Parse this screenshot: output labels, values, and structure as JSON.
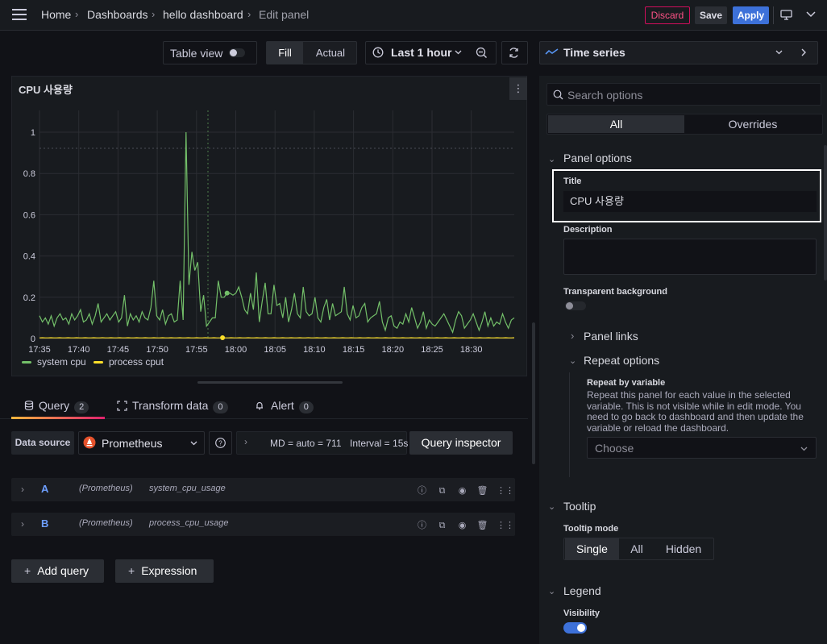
{
  "nav": {
    "breadcrumbs": [
      "Home",
      "Dashboards",
      "hello dashboard",
      "Edit panel"
    ],
    "discard": "Discard",
    "save": "Save",
    "apply": "Apply"
  },
  "toolbar": {
    "table_view": "Table view",
    "fill": "Fill",
    "actual": "Actual",
    "time_range": "Last 1 hour",
    "visualization": "Time series"
  },
  "panel": {
    "title": "CPU 사용량"
  },
  "chart_data": {
    "type": "line",
    "x_ticks": [
      "17:35",
      "17:40",
      "17:45",
      "17:50",
      "17:55",
      "18:00",
      "18:05",
      "18:10",
      "18:15",
      "18:20",
      "18:25",
      "18:30"
    ],
    "y_ticks": [
      "0",
      "0.2",
      "0.4",
      "0.6",
      "0.8",
      "1"
    ],
    "ylim": [
      0,
      1
    ],
    "series": [
      {
        "name": "system cpu",
        "color": "#73bf69",
        "values": [
          0.11,
          0.08,
          0.1,
          0.07,
          0.11,
          0.06,
          0.1,
          0.12,
          0.09,
          0.1,
          0.07,
          0.12,
          0.09,
          0.11,
          0.14,
          0.08,
          0.09,
          0.12,
          0.07,
          0.11,
          0.17,
          0.08,
          0.1,
          0.12,
          0.09,
          0.11,
          0.13,
          0.08,
          0.1,
          0.21,
          0.06,
          0.12,
          0.09,
          0.11,
          0.08,
          0.13,
          0.1,
          0.09,
          0.15,
          0.28,
          0.11,
          0.09,
          0.14,
          0.07,
          0.11,
          0.12,
          0.08,
          0.09,
          0.28,
          0.09,
          1.0,
          0.26,
          0.42,
          0.33,
          0.37,
          0.13,
          0.21,
          0.06,
          0.08,
          0.1,
          0.1,
          0.28,
          0.2,
          0.2,
          0.22,
          0.22,
          0.21,
          0.22,
          0.25,
          0.2,
          0.14,
          0.12,
          0.22,
          0.14,
          0.32,
          0.08,
          0.18,
          0.27,
          0.12,
          0.12,
          0.26,
          0.16,
          0.17,
          0.1,
          0.2,
          0.08,
          0.14,
          0.22,
          0.12,
          0.1,
          0.25,
          0.13,
          0.11,
          0.12,
          0.2,
          0.1,
          0.08,
          0.15,
          0.19,
          0.09,
          0.17,
          0.11,
          0.12,
          0.13,
          0.25,
          0.12,
          0.09,
          0.16,
          0.1,
          0.11,
          0.15,
          0.17,
          0.08,
          0.1,
          0.11,
          0.12,
          0.18,
          0.08,
          0.04,
          0.1,
          0.11,
          0.06,
          0.05,
          0.08,
          0.07,
          0.12,
          0.08,
          0.15,
          0.1,
          0.05,
          0.08,
          0.13,
          0.05,
          0.09,
          0.07,
          0.06,
          0.08,
          0.1,
          0.12,
          0.09,
          0.06,
          0.03,
          0.09,
          0.13,
          0.11,
          0.05,
          0.07,
          0.09,
          0.12,
          0.08,
          0.04,
          0.08,
          0.13,
          0.06,
          0.1,
          0.06,
          0.08,
          0.07,
          0.12,
          0.08,
          0.05,
          0.09,
          0.1
        ]
      },
      {
        "name": "process cput",
        "color": "#fade2a",
        "values": [
          0.003,
          0.004,
          0.003,
          0.003,
          0.004,
          0.003,
          0.003,
          0.004,
          0.003,
          0.003,
          0.004,
          0.003,
          0.003,
          0.004,
          0.003,
          0.003,
          0.004,
          0.003,
          0.003,
          0.004,
          0.003,
          0.003,
          0.004,
          0.003,
          0.003,
          0.004,
          0.003,
          0.003,
          0.004,
          0.003,
          0.003,
          0.004,
          0.003,
          0.003,
          0.004,
          0.003,
          0.003,
          0.004,
          0.003,
          0.003,
          0.004,
          0.003,
          0.003,
          0.004,
          0.003,
          0.003,
          0.004,
          0.003,
          0.003,
          0.004,
          0.003,
          0.003,
          0.004,
          0.003,
          0.003,
          0.004,
          0.003,
          0.003,
          0.004,
          0.003,
          0.003,
          0.004,
          0.003,
          0.003,
          0.004,
          0.003,
          0.003,
          0.004,
          0.003,
          0.003,
          0.004,
          0.003,
          0.003,
          0.004,
          0.003,
          0.003,
          0.004,
          0.003,
          0.003,
          0.004,
          0.003,
          0.003,
          0.004,
          0.003,
          0.003,
          0.004,
          0.003,
          0.003,
          0.004,
          0.003,
          0.003,
          0.004,
          0.003,
          0.003,
          0.004,
          0.003,
          0.003,
          0.004,
          0.003,
          0.003,
          0.004,
          0.003,
          0.003,
          0.004,
          0.003,
          0.003,
          0.004,
          0.003,
          0.003,
          0.004,
          0.003,
          0.003,
          0.004,
          0.003,
          0.003,
          0.004,
          0.003,
          0.003,
          0.004,
          0.003,
          0.003,
          0.004,
          0.003,
          0.003,
          0.004,
          0.003,
          0.003,
          0.004,
          0.003,
          0.003,
          0.004,
          0.003,
          0.003,
          0.004,
          0.003,
          0.003,
          0.004,
          0.003,
          0.003,
          0.004,
          0.003,
          0.003,
          0.004,
          0.003,
          0.003,
          0.004,
          0.003,
          0.003,
          0.004,
          0.003,
          0.003,
          0.004,
          0.003,
          0.003,
          0.004,
          0.003,
          0.003,
          0.004,
          0.003,
          0.003,
          0.004,
          0.003,
          0.003,
          0.004,
          0.003,
          0.003,
          0.004
        ]
      }
    ]
  },
  "query_tabs": [
    {
      "label": "Query",
      "count": "2"
    },
    {
      "label": "Transform data",
      "count": "0"
    },
    {
      "label": "Alert",
      "count": "0"
    }
  ],
  "datasource": {
    "label": "Data source",
    "name": "Prometheus",
    "options": "MD = auto = 711",
    "interval": "Interval = 15s",
    "inspector": "Query inspector"
  },
  "queries": [
    {
      "id": "A",
      "ds": "(Prometheus)",
      "metric": "system_cpu_usage"
    },
    {
      "id": "B",
      "ds": "(Prometheus)",
      "metric": "process_cpu_usage"
    }
  ],
  "actions": {
    "add_query": "Add query",
    "expression": "Expression"
  },
  "options": {
    "search_placeholder": "Search options",
    "tab_all": "All",
    "tab_overrides": "Overrides",
    "panel_options": "Panel options",
    "title_label": "Title",
    "title_value": "CPU 사용량",
    "description_label": "Description",
    "transparent_label": "Transparent background",
    "panel_links": "Panel links",
    "repeat_options": "Repeat options",
    "repeat_by_label": "Repeat by variable",
    "repeat_help": [
      "Repeat this panel for each value in the selected",
      "variable. This is not visible while in edit mode. You",
      "need to go back to dashboard and then update the",
      "variable or reload the dashboard."
    ],
    "choose": "Choose",
    "tooltip": "Tooltip",
    "tooltip_mode_label": "Tooltip mode",
    "tooltip_modes": [
      "Single",
      "All",
      "Hidden"
    ],
    "legend": "Legend",
    "visibility_label": "Visibility"
  }
}
